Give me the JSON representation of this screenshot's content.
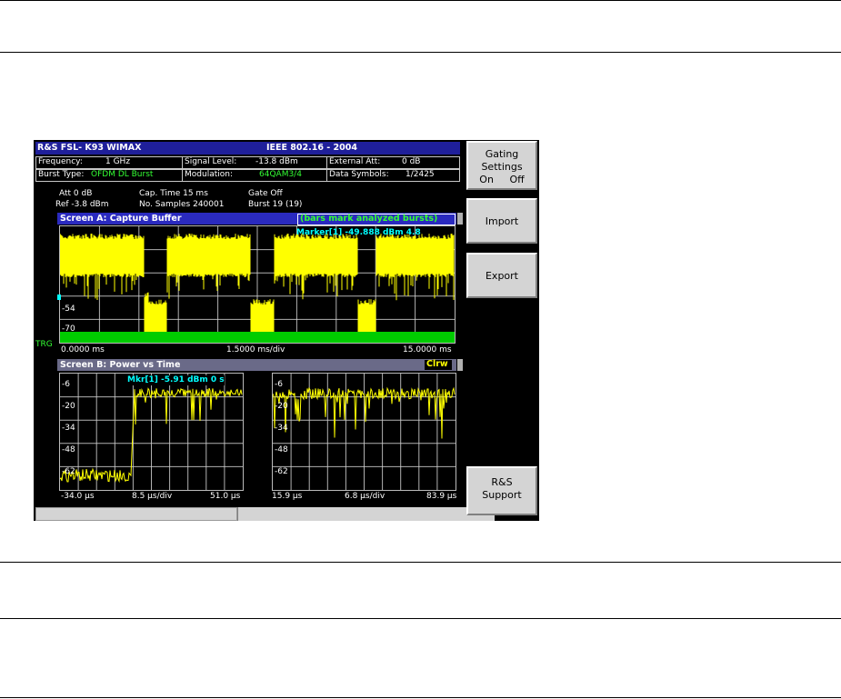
{
  "header": {
    "instrument": "R&S FSL- K93  WIMAX",
    "standard": "IEEE 802.16 - 2004"
  },
  "info": {
    "frequency_label": "Frequency:",
    "frequency_value": "1 GHz",
    "signal_level_label": "Signal Level:",
    "signal_level_value": "-13.8 dBm",
    "external_att_label": "External Att:",
    "external_att_value": "0 dB",
    "burst_type_label": "Burst Type:",
    "burst_type_value": "OFDM DL Burst",
    "modulation_label": "Modulation:",
    "modulation_value": "64QAM3/4",
    "data_symbols_label": "Data Symbols:",
    "data_symbols_value": "1/2425"
  },
  "settings": {
    "att": "Att    0 dB",
    "ref": "Ref  -3.8 dBm",
    "cap_time": "Cap. Time       15 ms",
    "no_samples": "No. Samples  240001",
    "gate": "Gate Off",
    "burst": "Burst 19 (19)"
  },
  "screen_a": {
    "title": "Screen A: Capture Buffer",
    "note": "(bars mark analyzed bursts)",
    "marker": "Marker[1]  -49.888 dBm  4.8",
    "y_ticks": [
      "-54",
      "-70"
    ],
    "trg": "TRG",
    "x_start": "0.0000 ms",
    "x_div": "1.5000 ms/div",
    "x_end": "15.0000 ms"
  },
  "screen_b": {
    "title": "Screen B: Power vs Time",
    "clrw": "Clrw",
    "marker": "Mkr[1]  -5.91 dBm  0 s",
    "left_y_ticks": [
      "-6",
      "-20",
      "-34",
      "-48",
      "-62"
    ],
    "right_y_ticks": [
      "-6",
      "-20",
      "-34",
      "-48",
      "-62"
    ],
    "left_x_start": "-34.0 µs",
    "left_x_div": "8.5 µs/div",
    "left_x_end": "51.0 µs",
    "right_x_start": "15.9 µs",
    "right_x_div": "6.8 µs/div",
    "right_x_end": "83.9 µs"
  },
  "softkeys": {
    "gating_line1": "Gating",
    "gating_line2": "Settings",
    "gating_on": "On",
    "gating_off": "Off",
    "import": "Import",
    "export": "Export",
    "support_line1": "R&S",
    "support_line2": "Support"
  },
  "colors": {
    "trace": "#ffff00",
    "burst_bar": "#00cc00",
    "title_bar": "#2a2abf",
    "marker": "#00ffff"
  }
}
